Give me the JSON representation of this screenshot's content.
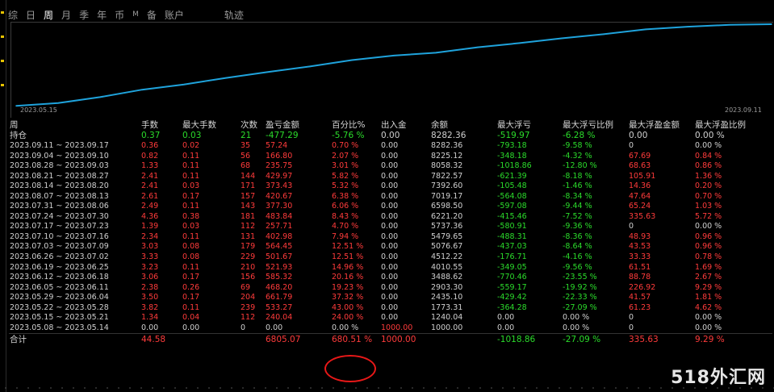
{
  "tabs": [
    {
      "label": "综",
      "active": false,
      "small": false
    },
    {
      "label": "日",
      "active": false,
      "small": false
    },
    {
      "label": "周",
      "active": true,
      "small": false
    },
    {
      "label": "月",
      "active": false,
      "small": false
    },
    {
      "label": "季",
      "active": false,
      "small": false
    },
    {
      "label": "年",
      "active": false,
      "small": false
    },
    {
      "label": "币",
      "active": false,
      "small": false
    },
    {
      "label": "M",
      "active": false,
      "small": true
    },
    {
      "label": "备",
      "active": false,
      "small": false
    },
    {
      "label": "账户",
      "active": false,
      "small": false
    },
    {
      "label": "轨迹",
      "active": false,
      "small": false,
      "track": true
    }
  ],
  "chart_data": {
    "type": "line",
    "x_start_label": "2023.05.15",
    "x_end_label": "2023.09.11",
    "x": [
      "2023.05.08",
      "2023.05.15",
      "2023.05.22",
      "2023.05.29",
      "2023.06.05",
      "2023.06.12",
      "2023.06.19",
      "2023.06.26",
      "2023.07.03",
      "2023.07.10",
      "2023.07.17",
      "2023.07.24",
      "2023.07.31",
      "2023.08.07",
      "2023.08.14",
      "2023.08.21",
      "2023.08.28",
      "2023.09.04",
      "2023.09.11"
    ],
    "series": [
      {
        "values": [
          1000.0,
          1240.04,
          1773.31,
          2435.1,
          2903.3,
          3488.62,
          4010.55,
          4512.22,
          5076.67,
          5479.65,
          5737.36,
          6221.2,
          6598.5,
          7019.17,
          7392.6,
          7822.57,
          8058.32,
          8225.12,
          8282.36
        ],
        "color": "#1fa3dc"
      }
    ],
    "grid": false,
    "legend": "none"
  },
  "table": {
    "headers": [
      "周",
      "手数",
      "最大手数",
      "次数",
      "盈亏金额",
      "百分比%",
      "出入金",
      "余额",
      "最大浮亏",
      "最大浮亏比例",
      "最大浮盈金额",
      "最大浮盈比例"
    ],
    "holding": {
      "cells": [
        {
          "v": "持仓",
          "c": "w"
        },
        {
          "v": "0.37",
          "c": "g"
        },
        {
          "v": "0.03",
          "c": "g"
        },
        {
          "v": "21",
          "c": "g"
        },
        {
          "v": "-477.29",
          "c": "g"
        },
        {
          "v": "-5.76 %",
          "c": "g"
        },
        {
          "v": "0.00",
          "c": "w"
        },
        {
          "v": "8282.36",
          "c": "w"
        },
        {
          "v": "-519.97",
          "c": "g"
        },
        {
          "v": "-6.28 %",
          "c": "g"
        },
        {
          "v": "0.00",
          "c": "w"
        },
        {
          "v": "0.00 %",
          "c": "w"
        }
      ]
    },
    "rows": [
      [
        "2023.09.11 ~ 2023.09.17",
        "0.36",
        "0.02",
        "35",
        "57.24",
        "0.70 %",
        "0.00",
        "8282.36",
        "-793.18",
        "-9.58 %",
        "0",
        "0.00 %"
      ],
      [
        "2023.09.04 ~ 2023.09.10",
        "0.82",
        "0.11",
        "56",
        "166.80",
        "2.07 %",
        "0.00",
        "8225.12",
        "-348.18",
        "-4.32 %",
        "67.69",
        "0.84 %"
      ],
      [
        "2023.08.28 ~ 2023.09.03",
        "1.33",
        "0.11",
        "68",
        "235.75",
        "3.01 %",
        "0.00",
        "8058.32",
        "-1018.86",
        "-12.80 %",
        "68.63",
        "0.86 %"
      ],
      [
        "2023.08.21 ~ 2023.08.27",
        "2.41",
        "0.11",
        "144",
        "429.97",
        "5.82 %",
        "0.00",
        "7822.57",
        "-621.39",
        "-8.18 %",
        "105.91",
        "1.36 %"
      ],
      [
        "2023.08.14 ~ 2023.08.20",
        "2.41",
        "0.03",
        "171",
        "373.43",
        "5.32 %",
        "0.00",
        "7392.60",
        "-105.48",
        "-1.46 %",
        "14.36",
        "0.20 %"
      ],
      [
        "2023.08.07 ~ 2023.08.13",
        "2.61",
        "0.17",
        "157",
        "420.67",
        "6.38 %",
        "0.00",
        "7019.17",
        "-564.08",
        "-8.34 %",
        "47.64",
        "0.70 %"
      ],
      [
        "2023.07.31 ~ 2023.08.06",
        "2.49",
        "0.11",
        "143",
        "377.30",
        "6.06 %",
        "0.00",
        "6598.50",
        "-597.08",
        "-9.44 %",
        "65.24",
        "1.03 %"
      ],
      [
        "2023.07.24 ~ 2023.07.30",
        "4.36",
        "0.38",
        "181",
        "483.84",
        "8.43 %",
        "0.00",
        "6221.20",
        "-415.46",
        "-7.52 %",
        "335.63",
        "5.72 %"
      ],
      [
        "2023.07.17 ~ 2023.07.23",
        "1.39",
        "0.03",
        "112",
        "257.71",
        "4.70 %",
        "0.00",
        "5737.36",
        "-580.91",
        "-9.36 %",
        "0",
        "0.00 %"
      ],
      [
        "2023.07.10 ~ 2023.07.16",
        "2.34",
        "0.11",
        "131",
        "402.98",
        "7.94 %",
        "0.00",
        "5479.65",
        "-488.31",
        "-8.36 %",
        "48.93",
        "0.96 %"
      ],
      [
        "2023.07.03 ~ 2023.07.09",
        "3.03",
        "0.08",
        "179",
        "564.45",
        "12.51 %",
        "0.00",
        "5076.67",
        "-437.03",
        "-8.64 %",
        "43.53",
        "0.96 %"
      ],
      [
        "2023.06.26 ~ 2023.07.02",
        "3.33",
        "0.08",
        "229",
        "501.67",
        "12.51 %",
        "0.00",
        "4512.22",
        "-176.71",
        "-4.16 %",
        "33.33",
        "0.78 %"
      ],
      [
        "2023.06.19 ~ 2023.06.25",
        "3.23",
        "0.11",
        "210",
        "521.93",
        "14.96 %",
        "0.00",
        "4010.55",
        "-349.05",
        "-9.56 %",
        "61.51",
        "1.69 %"
      ],
      [
        "2023.06.12 ~ 2023.06.18",
        "3.06",
        "0.17",
        "156",
        "585.32",
        "20.16 %",
        "0.00",
        "3488.62",
        "-770.46",
        "-23.55 %",
        "88.78",
        "2.67 %"
      ],
      [
        "2023.06.05 ~ 2023.06.11",
        "2.38",
        "0.26",
        "69",
        "468.20",
        "19.23 %",
        "0.00",
        "2903.30",
        "-559.17",
        "-19.92 %",
        "226.92",
        "9.29 %"
      ],
      [
        "2023.05.29 ~ 2023.06.04",
        "3.50",
        "0.17",
        "204",
        "661.79",
        "37.32 %",
        "0.00",
        "2435.10",
        "-429.42",
        "-22.33 %",
        "41.57",
        "1.81 %"
      ],
      [
        "2023.05.22 ~ 2023.05.28",
        "3.82",
        "0.11",
        "239",
        "533.27",
        "43.00 %",
        "0.00",
        "1773.31",
        "-364.28",
        "-27.09 %",
        "61.23",
        "4.62 %"
      ],
      [
        "2023.05.15 ~ 2023.05.21",
        "1.34",
        "0.04",
        "112",
        "240.04",
        "24.00 %",
        "0.00",
        "1240.04",
        "0.00",
        "0.00 %",
        "0",
        "0.00 %"
      ],
      [
        "2023.05.08 ~ 2023.05.14",
        "0.00",
        "0.00",
        "0",
        "0.00",
        "0.00 %",
        "1000.00",
        "1000.00",
        "0.00",
        "0.00 %",
        "0",
        "0.00 %"
      ]
    ],
    "row_colors": [
      "w",
      "r",
      "r",
      "r",
      "r",
      "r",
      "w",
      "w",
      "g",
      "g",
      "r",
      "r"
    ],
    "last_row_colors": [
      "w",
      "w",
      "w",
      "w",
      "w",
      "w",
      "r",
      "w",
      "w",
      "w",
      "w",
      "w"
    ],
    "total": {
      "cells": [
        {
          "v": "合计",
          "c": "w"
        },
        {
          "v": "44.58",
          "c": "r"
        },
        {
          "v": "",
          "c": "w"
        },
        {
          "v": "",
          "c": "w"
        },
        {
          "v": "6805.07",
          "c": "r"
        },
        {
          "v": "680.51 %",
          "c": "r"
        },
        {
          "v": "1000.00",
          "c": "r"
        },
        {
          "v": "",
          "c": "w"
        },
        {
          "v": "-1018.86",
          "c": "g"
        },
        {
          "v": "-27.09 %",
          "c": "g"
        },
        {
          "v": "335.63",
          "c": "r"
        },
        {
          "v": "9.29 %",
          "c": "r"
        }
      ]
    }
  },
  "watermark": "518外汇网",
  "colors": {
    "line": "#1fa3dc",
    "positive": "#ff3b3b",
    "negative": "#2bdc2b",
    "highlight_circle": "#e81818"
  }
}
